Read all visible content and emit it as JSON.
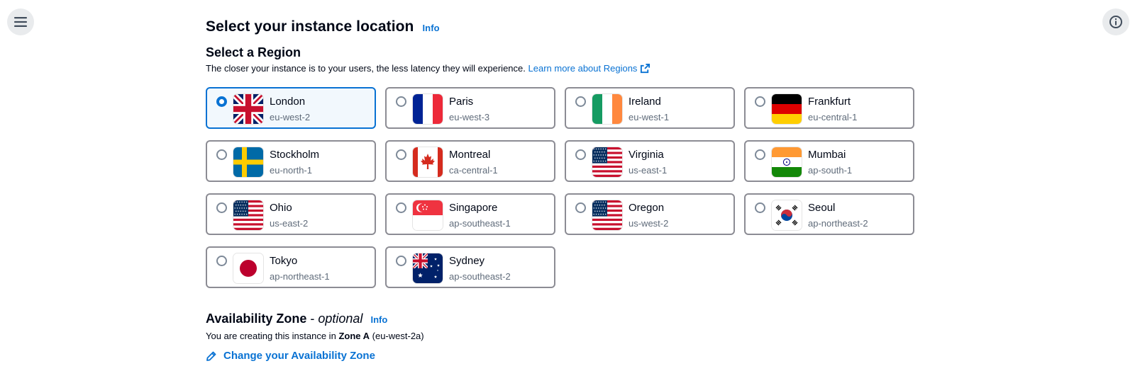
{
  "header": {
    "menu_icon": "hamburger-menu-icon",
    "info_icon": "info-circle-icon"
  },
  "location": {
    "title": "Select your instance location",
    "info_label": "Info"
  },
  "region": {
    "title": "Select a Region",
    "description": "The closer your instance is to your users, the less latency they will experience.",
    "learn_more": "Learn more about Regions",
    "selected_index": 0,
    "items": [
      {
        "city": "London",
        "code": "eu-west-2",
        "flag": "uk-flag-icon"
      },
      {
        "city": "Paris",
        "code": "eu-west-3",
        "flag": "france-flag-icon"
      },
      {
        "city": "Ireland",
        "code": "eu-west-1",
        "flag": "ireland-flag-icon"
      },
      {
        "city": "Frankfurt",
        "code": "eu-central-1",
        "flag": "germany-flag-icon"
      },
      {
        "city": "Stockholm",
        "code": "eu-north-1",
        "flag": "sweden-flag-icon"
      },
      {
        "city": "Montreal",
        "code": "ca-central-1",
        "flag": "canada-flag-icon"
      },
      {
        "city": "Virginia",
        "code": "us-east-1",
        "flag": "usa-flag-icon"
      },
      {
        "city": "Mumbai",
        "code": "ap-south-1",
        "flag": "india-flag-icon"
      },
      {
        "city": "Ohio",
        "code": "us-east-2",
        "flag": "usa-flag-icon"
      },
      {
        "city": "Singapore",
        "code": "ap-southeast-1",
        "flag": "singapore-flag-icon"
      },
      {
        "city": "Oregon",
        "code": "us-west-2",
        "flag": "usa-flag-icon"
      },
      {
        "city": "Seoul",
        "code": "ap-northeast-2",
        "flag": "south-korea-flag-icon"
      },
      {
        "city": "Tokyo",
        "code": "ap-northeast-1",
        "flag": "japan-flag-icon"
      },
      {
        "city": "Sydney",
        "code": "ap-southeast-2",
        "flag": "australia-flag-icon"
      }
    ]
  },
  "availability_zone": {
    "title": "Availability Zone",
    "separator": " - ",
    "optional": "optional",
    "info_label": "Info",
    "text_prefix": "You are creating this instance in",
    "zone": "Zone A",
    "zone_code": "(eu-west-2a)",
    "change_link": "Change your Availability Zone"
  },
  "colors": {
    "accent": "#0972d3",
    "selected_bg": "#f2f8fd",
    "tile_border": "#8c8c94",
    "muted_text": "#5f6b7a"
  }
}
